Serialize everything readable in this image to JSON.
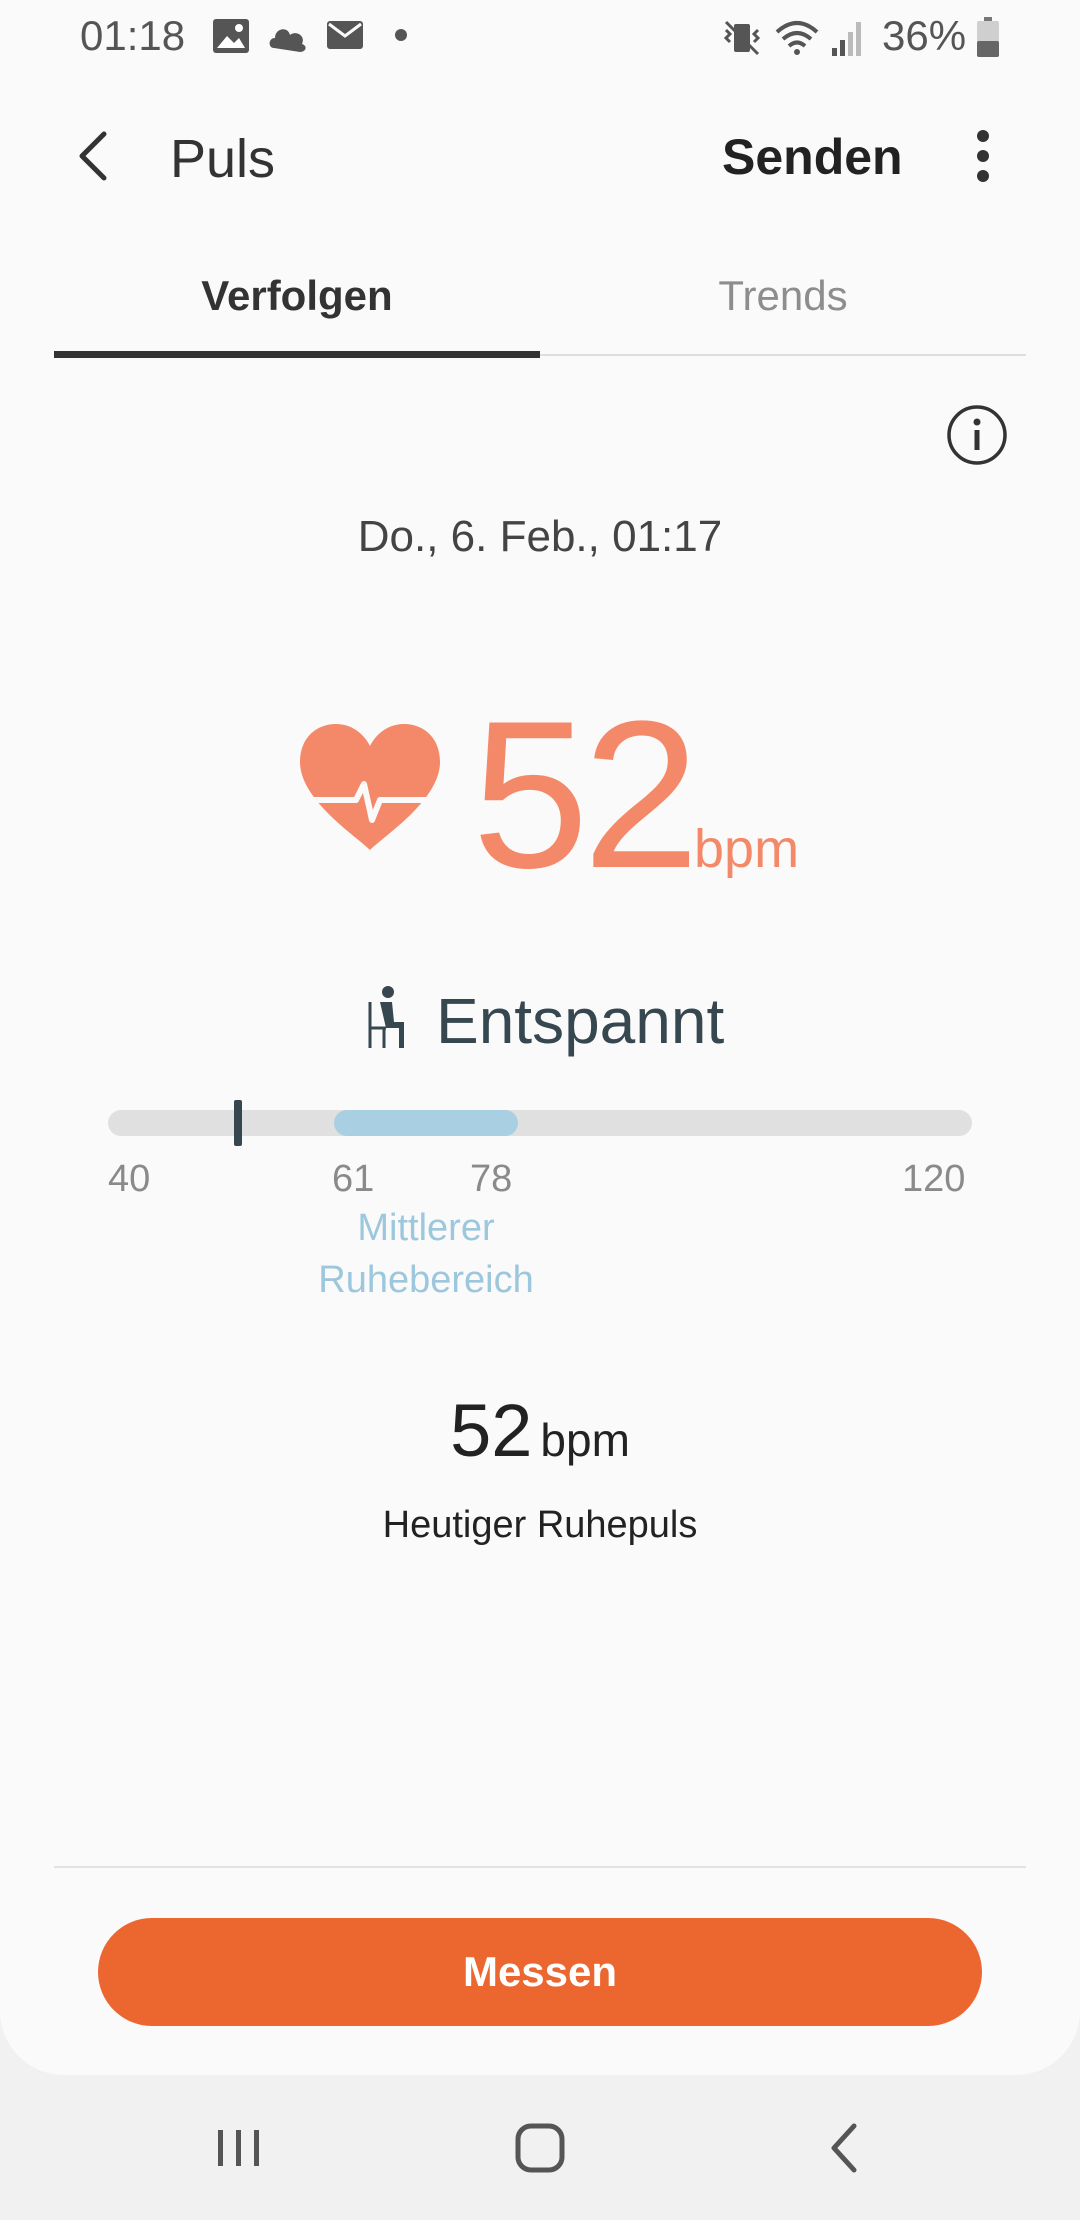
{
  "status_bar": {
    "time": "01:18",
    "notification_icons": [
      "image-icon",
      "cloud-icon",
      "mail-icon",
      "dot-icon"
    ],
    "system_icons": [
      "vibrate-icon",
      "wifi-icon",
      "signal-icon"
    ],
    "battery_percent": "36%"
  },
  "app_bar": {
    "back_icon": "chevron-left-icon",
    "title": "Puls",
    "send_label": "Senden",
    "more_icon": "more-vert-icon"
  },
  "tabs": [
    {
      "label": "Verfolgen",
      "selected": true
    },
    {
      "label": "Trends",
      "selected": false
    }
  ],
  "info_icon": "info-icon",
  "measurement": {
    "date": "Do., 6. Feb., 01:17",
    "value": "52",
    "unit": "bpm",
    "status_icon": "sitting-person-icon",
    "status": "Entspannt"
  },
  "range": {
    "min_label": "40",
    "low_label": "61",
    "high_label": "78",
    "max_label": "120",
    "min": 40,
    "max": 120,
    "normal_low": 61,
    "normal_high": 78,
    "current": 52,
    "caption": "Mittlerer Ruhebereich"
  },
  "resting": {
    "value": "52",
    "unit": "bpm",
    "label": "Heutiger Ruhepuls"
  },
  "measure_button": "Messen",
  "colors": {
    "accent_orange": "#ec6630",
    "heart_rate": "#f4896a",
    "normal_range": "#a9cfe2",
    "marker": "#37474f"
  },
  "nav_bar": [
    "recents-icon",
    "home-icon",
    "back-icon"
  ]
}
